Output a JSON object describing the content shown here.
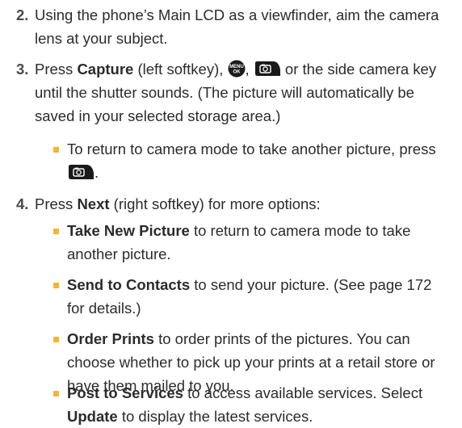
{
  "steps": [
    {
      "num": "2.",
      "text": "Using the phone’s Main LCD as a viewfinder, aim the camera lens at your subject."
    },
    {
      "num": "3.",
      "press": "Press ",
      "capture": "Capture",
      "capture_note": " (left softkey),",
      "comma": ",",
      "rest": " or the side camera key until the shutter sounds. (The picture will automatically be saved in your selected storage area.)",
      "sub": {
        "text": "To return to camera mode to take another picture, press",
        "end": "."
      }
    },
    {
      "num": "4.",
      "press": "Press ",
      "next": "Next",
      "rest": " (right softkey) for more options:",
      "options": [
        {
          "title": "Take New Picture",
          "text": " to return to camera mode to take another picture."
        },
        {
          "title": "Send to Contacts",
          "text": " to send your picture. (See page 172 for details.)"
        },
        {
          "title": "Order Prints",
          "text": " to order prints of the pictures. You can choose whether to pick up your prints at a retail store or have them mailed to you."
        },
        {
          "title": "Post to Services",
          "text": " to access available services. Select ",
          "bold2": "Update",
          "text2": " to display the latest services."
        }
      ]
    }
  ],
  "icons": {
    "menu_ok": {
      "name": "menu-ok-key-icon",
      "line1": "MENU",
      "line2": "OK"
    },
    "camera": {
      "name": "camera-key-icon"
    }
  },
  "colors": {
    "bullet": "#f3b33d",
    "key_fill": "#1a1a1a",
    "text": "#2b2b2b"
  }
}
